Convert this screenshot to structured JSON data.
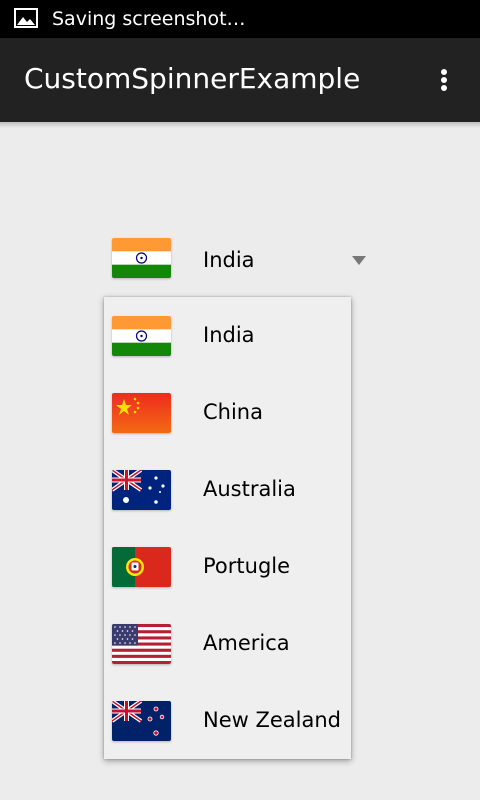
{
  "status_bar": {
    "notification_icon": "image-icon",
    "text": "Saving screenshot…"
  },
  "action_bar": {
    "title": "CustomSpinnerExample",
    "menu_icon": "overflow-menu-icon"
  },
  "spinner": {
    "selected": {
      "label": "India",
      "flag_icon": "india-flag-icon"
    },
    "arrow_icon": "dropdown-arrow-icon"
  },
  "dropdown": {
    "items": [
      {
        "label": "India",
        "flag_icon": "india-flag-icon"
      },
      {
        "label": "China",
        "flag_icon": "china-flag-icon"
      },
      {
        "label": "Australia",
        "flag_icon": "australia-flag-icon"
      },
      {
        "label": "Portugle",
        "flag_icon": "portugal-flag-icon"
      },
      {
        "label": "America",
        "flag_icon": "usa-flag-icon"
      },
      {
        "label": "New Zealand",
        "flag_icon": "new-zealand-flag-icon"
      }
    ]
  },
  "colors": {
    "status_bar": "#000000",
    "action_bar": "#222222",
    "background": "#ececec",
    "dropdown_background": "#efefef"
  }
}
